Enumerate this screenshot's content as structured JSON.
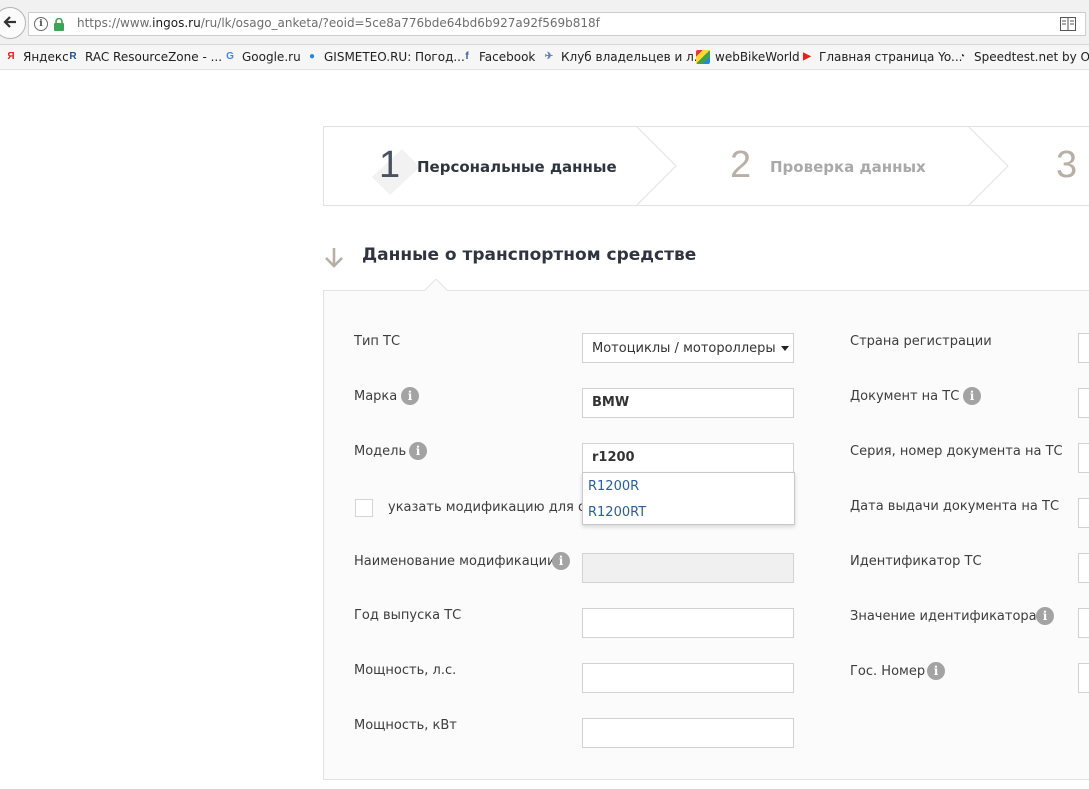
{
  "browser": {
    "url_prefix": "https://www.",
    "url_domain": "ingos.ru",
    "url_rest": "/ru/lk/osago_anketa/?eoid=5ce8a776bde64bd6b927a92f569b818f",
    "bookmarks": [
      {
        "label": "Яндекс",
        "icon": "yandex-icon",
        "glyph": "Я",
        "color": "#e41d1d"
      },
      {
        "label": "RAC ResourceZone - ...",
        "icon": "rac-icon",
        "glyph": "R",
        "color": "#1e4f9a"
      },
      {
        "label": "Google.ru",
        "icon": "google-icon",
        "glyph": "G",
        "color": "#4285f4"
      },
      {
        "label": "GISMETEO.RU: Погод...",
        "icon": "gismeteo-icon",
        "glyph": "●",
        "color": "#1e88e5"
      },
      {
        "label": "Facebook",
        "icon": "facebook-icon",
        "glyph": "f",
        "color": "#3b5998"
      },
      {
        "label": "Клуб владельцев и л...",
        "icon": "club-icon",
        "glyph": "✈",
        "color": "#5a7fb0"
      },
      {
        "label": "webBikeWorld",
        "icon": "webbikeworld-icon",
        "glyph": "",
        "color": "#3aa655"
      },
      {
        "label": "Главная страница Yo...",
        "icon": "youtube-icon",
        "glyph": "▶",
        "color": "#e62117"
      },
      {
        "label": "Speedtest.net by Ookla",
        "icon": "speedtest-icon",
        "glyph": "◔",
        "color": "#333333"
      }
    ]
  },
  "stepper": {
    "steps": [
      {
        "num": "1",
        "label": "Персональные данные",
        "active": true
      },
      {
        "num": "2",
        "label": "Проверка данных",
        "active": false
      },
      {
        "num": "3",
        "label": "",
        "active": false
      }
    ]
  },
  "section": {
    "title": "Данные о транспортном средстве"
  },
  "form": {
    "left": {
      "vehicle_type": {
        "label": "Тип ТС",
        "value": "Мотоциклы / мотороллеры"
      },
      "make": {
        "label": "Марка",
        "value": "BMW"
      },
      "model": {
        "label": "Модель",
        "value": "r1200"
      },
      "model_suggestions": [
        "R1200R",
        "R1200RT"
      ],
      "modification_checkbox": {
        "label": "указать модификацию для от"
      },
      "modification_name": {
        "label": "Наименование модификации",
        "value": ""
      },
      "year": {
        "label": "Год выпуска ТС",
        "value": ""
      },
      "power_hp": {
        "label": "Мощность, л.с.",
        "value": ""
      },
      "power_kw": {
        "label": "Мощность, кВт",
        "value": ""
      }
    },
    "right": {
      "reg_country": {
        "label": "Страна регистрации"
      },
      "vehicle_doc": {
        "label": "Документ на ТС"
      },
      "doc_series_number": {
        "label": "Серия, номер документа на ТС"
      },
      "doc_issue_date": {
        "label": "Дата выдачи документа на ТС"
      },
      "vehicle_id": {
        "label": "Идентификатор ТС"
      },
      "id_value": {
        "label": "Значение идентификатора"
      },
      "plate_number": {
        "label": "Гос. Номер"
      }
    }
  },
  "colors": {
    "accent": "#2f3540",
    "link": "#2a5f9a",
    "muted": "#b8b0a6"
  }
}
